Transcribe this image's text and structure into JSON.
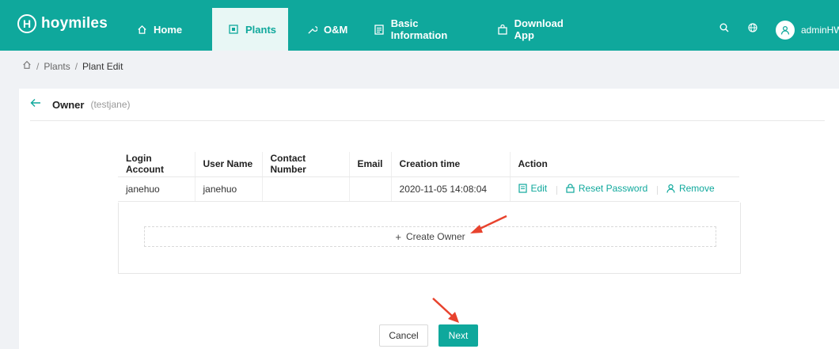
{
  "brand": {
    "name": "hoymiles",
    "mark": "H"
  },
  "nav": {
    "items": [
      {
        "label": "Home",
        "icon": "home-icon"
      },
      {
        "label": "Plants",
        "icon": "plants-icon"
      },
      {
        "label": "O&M",
        "icon": "wrench-icon"
      },
      {
        "label": "Basic Information",
        "icon": "info-icon"
      },
      {
        "label": "Download App",
        "icon": "bag-icon"
      }
    ],
    "user": "adminHW"
  },
  "breadcrumb": {
    "level1": "Plants",
    "level2": "Plant Edit"
  },
  "header": {
    "title": "Owner",
    "subtitle": "(testjane)"
  },
  "table": {
    "columns": [
      "Login Account",
      "User Name",
      "Contact Number",
      "Email",
      "Creation time",
      "Action"
    ],
    "rows": [
      {
        "login": "janehuo",
        "user": "janehuo",
        "contact": "",
        "email": "",
        "created": "2020-11-05 14:08:04"
      }
    ],
    "actions": {
      "edit": "Edit",
      "reset": "Reset Password",
      "remove": "Remove"
    }
  },
  "create_owner": "Create Owner",
  "buttons": {
    "cancel": "Cancel",
    "next": "Next"
  },
  "colors": {
    "accent": "#0fa89c",
    "arrow": "#e8432e"
  }
}
